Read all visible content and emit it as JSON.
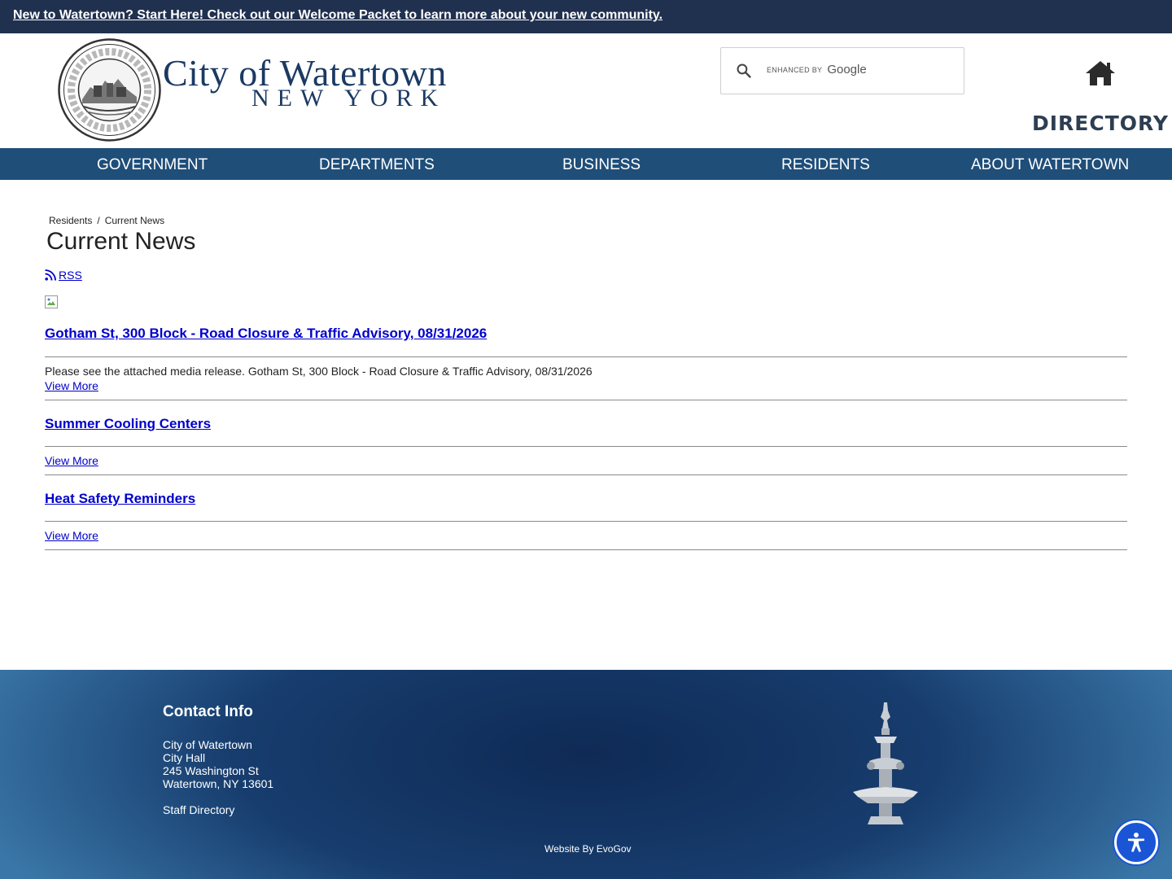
{
  "alert": {
    "text": "New to Watertown? Start Here! Check out our Welcome Packet to learn more about your new community."
  },
  "header": {
    "brand_line1": "City of Watertown",
    "brand_line2": "NEW YORK",
    "search": {
      "enhanced_label": "ENHANCED BY",
      "provider": "Google",
      "value": ""
    },
    "directory_label": "DIRECTORY"
  },
  "nav": {
    "items": [
      {
        "label": "GOVERNMENT"
      },
      {
        "label": "DEPARTMENTS"
      },
      {
        "label": "BUSINESS"
      },
      {
        "label": "RESIDENTS"
      },
      {
        "label": "ABOUT WATERTOWN"
      }
    ]
  },
  "breadcrumb": {
    "items": [
      "Residents",
      "Current News"
    ],
    "separator": "/"
  },
  "page": {
    "title": "Current News",
    "rss_label": "RSS"
  },
  "news": [
    {
      "title": "Gotham St, 300 Block - Road Closure & Traffic Advisory, 08/31/2026",
      "summary": "Please see the attached media release. Gotham St, 300 Block - Road Closure & Traffic Advisory, 08/31/2026",
      "view_more": "View More"
    },
    {
      "title": "Summer Cooling Centers",
      "summary": "",
      "view_more": "View More"
    },
    {
      "title": "Heat Safety Reminders",
      "summary": "",
      "view_more": "View More"
    }
  ],
  "footer": {
    "contact_title": "Contact Info",
    "lines": [
      "City of Watertown",
      "City Hall",
      "245 Washington St",
      "Watertown, NY 13601"
    ],
    "staff_directory": "Staff Directory",
    "credit": "Website By EvoGov"
  },
  "colors": {
    "alert_bg": "#20304f",
    "nav_bg": "#1f4e79",
    "brand": "#1b3a63",
    "link": "#0000cc",
    "accessibility": "#1a55d6"
  }
}
